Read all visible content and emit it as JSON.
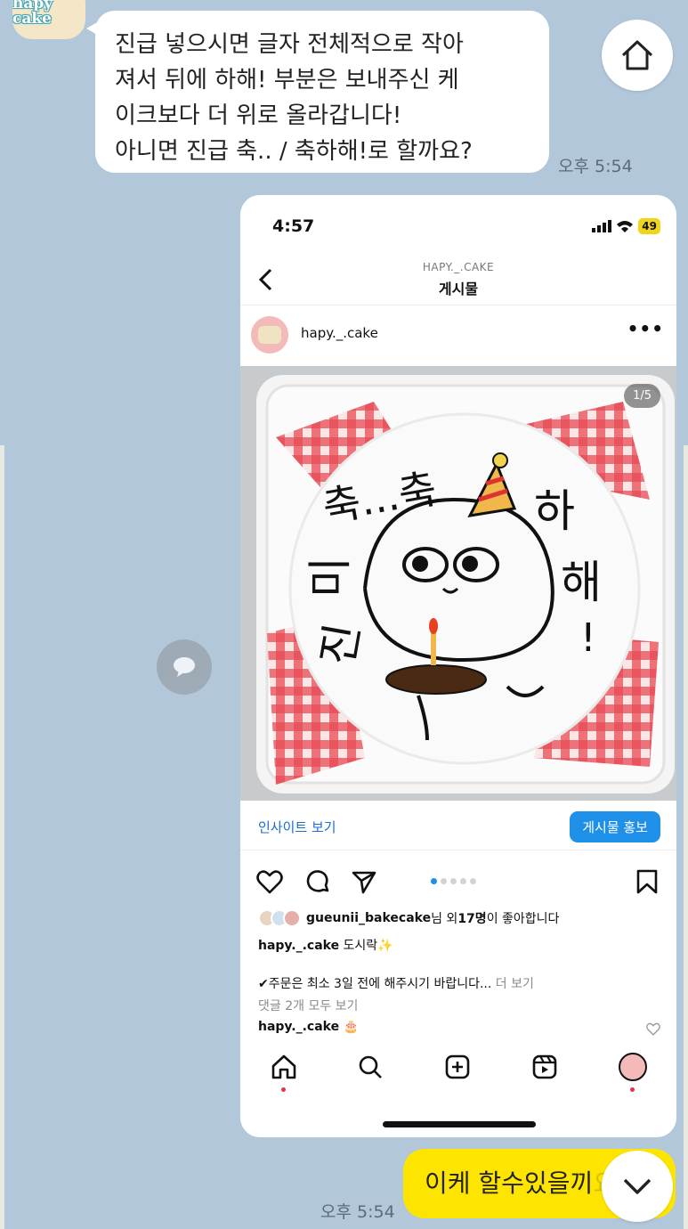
{
  "chat": {
    "sender_logo": "hapy cake",
    "incoming_lines": [
      "진급 넣으시면 글자 전체적으로 작아",
      "져서 뒤에 하해! 부분은 보내주신 케",
      "이크보다 더 위로 올라갑니다!",
      "아니면 진급 축.. / 축하해!로 할까요?"
    ],
    "incoming_time": "오후 5:54",
    "outgoing_text": "이케 할수있을끼",
    "outgoing_faded_tail": "요?",
    "outgoing_time": "오후 5:54"
  },
  "screenshot": {
    "status_time": "4:57",
    "battery": "49",
    "nav_account": "HAPY._.CAKE",
    "nav_title": "게시물",
    "username": "hapy._.cake",
    "more_label": "•••",
    "image_counter": "1/5",
    "insight_label": "인사이트 보기",
    "promote_label": "게시물 홍보",
    "likes_user": "gueunii_bakecake",
    "likes_suffix_1": "님 외 ",
    "likes_count": "17명",
    "likes_suffix_2": "이 좋아합니다",
    "caption_user": "hapy._.cake",
    "caption_text": "도시락✨",
    "notice_text": "✔주문은 최소 3일 전에 해주시기 바랍니다...",
    "more_text": "더 보기",
    "comments_link": "댓글 2개 모두 보기",
    "comment_user": "hapy._.cake",
    "comment_text": "🎂",
    "cake_text": {
      "word_top": "축...축",
      "word_right_1": "하",
      "word_right_2": "해",
      "word_right_3": "!",
      "word_left_1": "미",
      "word_left_2": "진"
    }
  },
  "colors": {
    "chat_bg": "#b2c7da",
    "outgoing_bubble": "#fee500",
    "instagram_blue": "#1e90e8"
  }
}
